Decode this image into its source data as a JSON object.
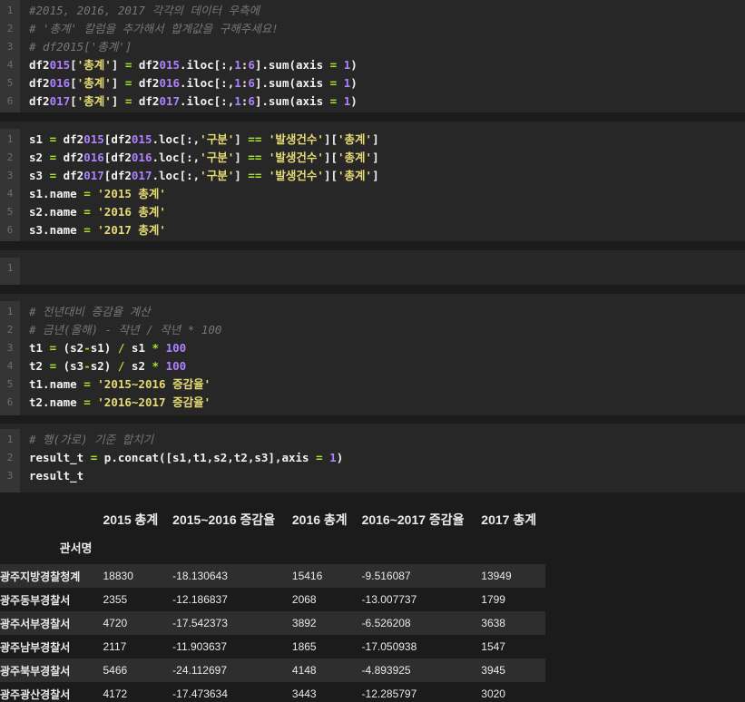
{
  "cells": [
    {
      "lines": [
        {
          "n": "1",
          "t": "#2015, 2016, 2017 각각의 데이터 우측에",
          "comment": true
        },
        {
          "n": "2",
          "t": "# '총계' 칼럼을 추가해서 합계값을 구해주세요!",
          "comment": true
        },
        {
          "n": "3",
          "t": "# df2015['총계']",
          "comment": true
        },
        {
          "n": "4",
          "t": "df2015['총계'] = df2015.iloc[:,1:6].sum(axis = 1)"
        },
        {
          "n": "5",
          "t": "df2016['총계'] = df2016.iloc[:,1:6].sum(axis = 1)"
        },
        {
          "n": "6",
          "t": "df2017['총계'] = df2017.iloc[:,1:6].sum(axis = 1)"
        }
      ]
    },
    {
      "lines": [
        {
          "n": "1",
          "t": "s1 = df2015[df2015.loc[:,'구분'] == '발생건수']['총계']"
        },
        {
          "n": "2",
          "t": "s2 = df2016[df2016.loc[:,'구분'] == '발생건수']['총계']"
        },
        {
          "n": "3",
          "t": "s3 = df2017[df2017.loc[:,'구분'] == '발생건수']['총계']"
        },
        {
          "n": "4",
          "t": "s1.name = '2015 총계'"
        },
        {
          "n": "5",
          "t": "s2.name = '2016 총계'"
        },
        {
          "n": "6",
          "t": "s3.name = '2017 총계'"
        }
      ]
    },
    {
      "lines": [
        {
          "n": "1",
          "t": ""
        }
      ]
    },
    {
      "lines": [
        {
          "n": "1",
          "t": "# 전년대비 증감율 계산",
          "comment": true
        },
        {
          "n": "2",
          "t": "# 금년(올해) - 작년 / 작년 * 100",
          "comment": true
        },
        {
          "n": "3",
          "t": "t1 = (s2-s1) / s1 * 100"
        },
        {
          "n": "4",
          "t": "t2 = (s3-s2) / s2 * 100"
        },
        {
          "n": "5",
          "t": "t1.name = '2015~2016 증감율'"
        },
        {
          "n": "6",
          "t": "t2.name = '2016~2017 증감율'"
        }
      ]
    },
    {
      "lines": [
        {
          "n": "1",
          "t": "# 행(가로) 기준 합치기",
          "comment": true
        },
        {
          "n": "2",
          "t": "result_t = p.concat([s1,t1,s2,t2,s3],axis = 1)"
        },
        {
          "n": "3",
          "t": "result_t"
        }
      ]
    }
  ],
  "output": {
    "index_name": "관서명",
    "columns": [
      "2015 총계",
      "2015~2016 증감율",
      "2016 총계",
      "2016~2017 증감율",
      "2017 총계"
    ],
    "rows": [
      {
        "name": "광주지방경찰청계",
        "values": [
          "18830",
          "-18.130643",
          "15416",
          "-9.516087",
          "13949"
        ]
      },
      {
        "name": "광주동부경찰서",
        "values": [
          "2355",
          "-12.186837",
          "2068",
          "-13.007737",
          "1799"
        ]
      },
      {
        "name": "광주서부경찰서",
        "values": [
          "4720",
          "-17.542373",
          "3892",
          "-6.526208",
          "3638"
        ]
      },
      {
        "name": "광주남부경찰서",
        "values": [
          "2117",
          "-11.903637",
          "1865",
          "-17.050938",
          "1547"
        ]
      },
      {
        "name": "광주북부경찰서",
        "values": [
          "5466",
          "-24.112697",
          "4148",
          "-4.893925",
          "3945"
        ]
      },
      {
        "name": "광주광산경찰서",
        "values": [
          "4172",
          "-17.473634",
          "3443",
          "-12.285797",
          "3020"
        ]
      }
    ]
  },
  "colors": {
    "string": "#e6db74",
    "number": "#ae81ff",
    "operator": "#a6e22e",
    "comment": "#777777"
  }
}
